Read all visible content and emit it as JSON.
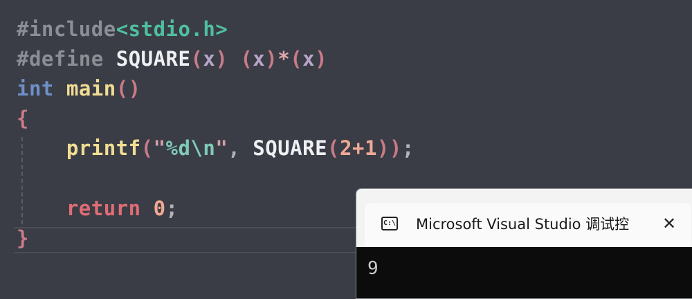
{
  "code": {
    "line1": {
      "directive": "#include",
      "header": "<stdio.h>"
    },
    "line2": {
      "directive": "#define ",
      "macro": "SQUARE",
      "lp": "(",
      "param": "x",
      "rp": ")",
      "sp": " ",
      "lp2": "(",
      "x2": "x",
      "rp2": ")",
      "star": "*",
      "lp3": "(",
      "x3": "x",
      "rp3": ")"
    },
    "line3": {
      "type": "int",
      "sp": " ",
      "name": "main",
      "parens": "()"
    },
    "line4": {
      "brace": "{"
    },
    "line5": {
      "indent": "    ",
      "func": "printf",
      "lp": "(",
      "q1": "\"",
      "fmt": "%d\\n",
      "q2": "\"",
      "comma": ", ",
      "macro": "SQUARE",
      "lp2": "(",
      "n1": "2",
      "plus": "+",
      "n2": "1",
      "rp2": ")",
      "rp": ")",
      "semi": ";"
    },
    "line7": {
      "indent": "    ",
      "kw": "return",
      "sp": " ",
      "num": "0",
      "semi": ";"
    },
    "line8": {
      "brace": "}"
    }
  },
  "console": {
    "icon": "cmd-icon",
    "icon_text": "C:\\",
    "title": "Microsoft Visual Studio 调试控",
    "close": "✕",
    "output": "9"
  }
}
